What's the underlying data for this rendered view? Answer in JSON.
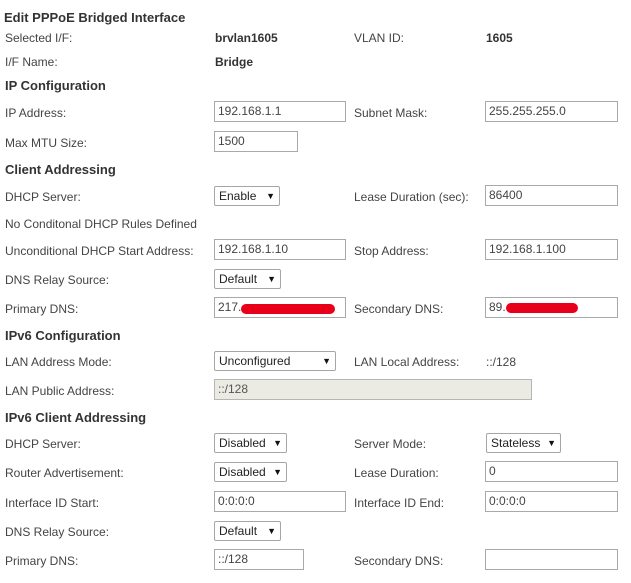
{
  "title": "Edit PPPoE Bridged Interface",
  "info": {
    "selected_if_label": "Selected I/F:",
    "selected_if_value": "brvlan1605",
    "vlan_id_label": "VLAN ID:",
    "vlan_id_value": "1605",
    "if_name_label": "I/F Name:",
    "if_name_value": "Bridge"
  },
  "ip_config": {
    "heading": "IP Configuration",
    "ip_address_label": "IP Address:",
    "ip_address_value": "192.168.1.1",
    "subnet_mask_label": "Subnet Mask:",
    "subnet_mask_value": "255.255.255.0",
    "mtu_label": "Max MTU Size:",
    "mtu_value": "1500"
  },
  "client_addressing": {
    "heading": "Client Addressing",
    "dhcp_server_label": "DHCP Server:",
    "dhcp_server_value": "Enable",
    "lease_duration_label": "Lease Duration (sec):",
    "lease_duration_value": "86400",
    "no_rules_text": "No Conditonal DHCP Rules Defined",
    "start_address_label": "Unconditional DHCP Start Address:",
    "start_address_value": "192.168.1.10",
    "stop_address_label": "Stop Address:",
    "stop_address_value": "192.168.1.100",
    "dns_relay_label": "DNS Relay Source:",
    "dns_relay_value": "Default",
    "primary_dns_label": "Primary DNS:",
    "primary_dns_value": "217.",
    "secondary_dns_label": "Secondary DNS:",
    "secondary_dns_value": "89."
  },
  "ipv6_config": {
    "heading": "IPv6 Configuration",
    "lan_mode_label": "LAN Address Mode:",
    "lan_mode_value": "Unconfigured",
    "lan_local_label": "LAN Local Address:",
    "lan_local_value": "::/128",
    "lan_public_label": "LAN Public Address:",
    "lan_public_value": "::/128"
  },
  "ipv6_client": {
    "heading": "IPv6 Client Addressing",
    "dhcp_server_label": "DHCP Server:",
    "dhcp_server_value": "Disabled",
    "server_mode_label": "Server Mode:",
    "server_mode_value": "Stateless",
    "router_adv_label": "Router Advertisement:",
    "router_adv_value": "Disabled",
    "lease_duration_label": "Lease Duration:",
    "lease_duration_value": "0",
    "if_id_start_label": "Interface ID Start:",
    "if_id_start_value": "0:0:0:0",
    "if_id_end_label": "Interface ID End:",
    "if_id_end_value": "0:0:0:0",
    "dns_relay_label": "DNS Relay Source:",
    "dns_relay_value": "Default",
    "primary_dns_label": "Primary DNS:",
    "primary_dns_value": "::/128",
    "secondary_dns_label": "Secondary DNS:",
    "secondary_dns_value": ""
  },
  "icons": {
    "dropdown_arrow": "▼"
  },
  "colors": {
    "redaction": "#e8001a",
    "disabled_field": "#ebebe4"
  }
}
